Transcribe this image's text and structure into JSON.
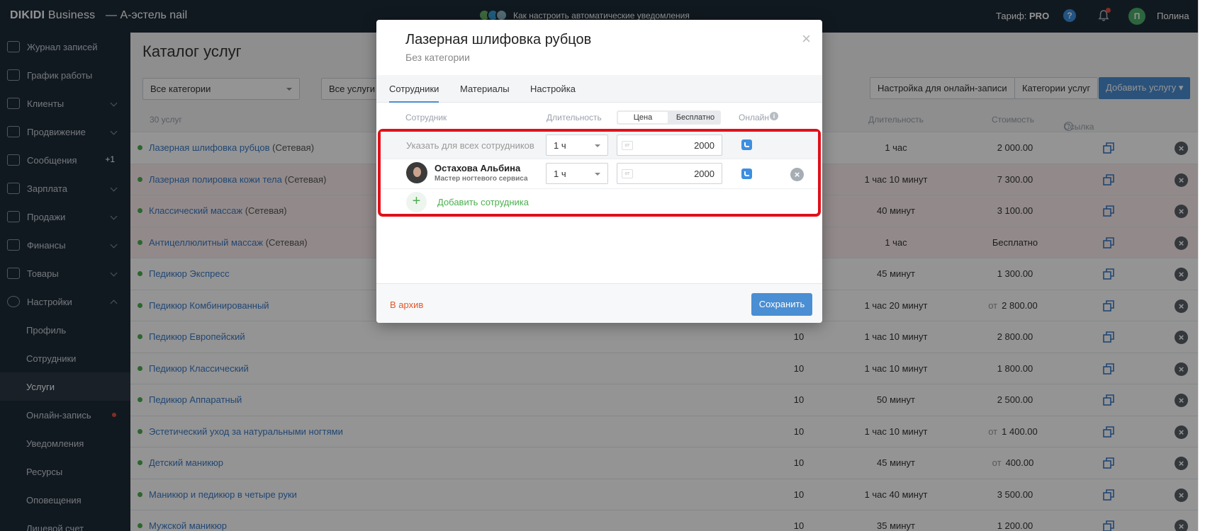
{
  "topbar": {
    "brand_bold": "DIKIDI",
    "brand_thin": " Business",
    "salon": "— А-эстель nail",
    "notify_banner": "Как настроить автоматические уведомления",
    "tariff_label": "Тариф:",
    "tariff_value": "PRO",
    "help": "?",
    "avatar_letter": "П",
    "username": "Полина"
  },
  "sidebar": {
    "items": [
      {
        "label": "Журнал записей"
      },
      {
        "label": "График работы"
      },
      {
        "label": "Клиенты"
      },
      {
        "label": "Продвижение"
      },
      {
        "label": "Сообщения",
        "badge": "+1"
      },
      {
        "label": "Зарплата"
      },
      {
        "label": "Продажи"
      },
      {
        "label": "Финансы"
      },
      {
        "label": "Товары"
      },
      {
        "label": "Настройки"
      }
    ],
    "sub_items": [
      "Профиль",
      "Сотрудники",
      "Услуги",
      "Онлайн-запись",
      "Уведомления",
      "Ресурсы",
      "Оповещения",
      "Лицевой счет"
    ]
  },
  "main": {
    "title": "Каталог услуг",
    "filter_category": "Все категории",
    "filter_services": "Все услуги",
    "btn_online": "Настройка для онлайн-записи",
    "btn_categories": "Категории услуг",
    "btn_add": "Добавить услугу ▾",
    "head": {
      "count": "30 услуг",
      "duration": "Длительность",
      "price": "Стоимость",
      "link": "Ссылка на запись"
    },
    "rows": [
      {
        "name": "Лазерная шлифовка рубцов",
        "net": " (Сетевая)",
        "count": "",
        "duration": "1 час",
        "from": "",
        "price": "2 000.00"
      },
      {
        "name": "Лазерная полировка кожи тела",
        "net": " (Сетевая)",
        "count": "",
        "duration": "1 час 10 минут",
        "from": "",
        "price": "7 300.00"
      },
      {
        "name": "Классический массаж",
        "net": " (Сетевая)",
        "count": "",
        "duration": "40 минут",
        "from": "",
        "price": "3 100.00"
      },
      {
        "name": "Антицеллюлитный массаж",
        "net": " (Сетевая)",
        "count": "",
        "duration": "1 час",
        "from": "",
        "price": "Бесплатно"
      },
      {
        "name": "Педикюр Экспресс",
        "net": "",
        "count": "",
        "duration": "45 минут",
        "from": "",
        "price": "1 300.00"
      },
      {
        "name": "Педикюр Комбинированный",
        "net": "",
        "count": "",
        "duration": "1 час 20 минут",
        "from": "от",
        "price": "2 800.00"
      },
      {
        "name": "Педикюр Европейский",
        "net": "",
        "count": "10",
        "duration": "1 час 10 минут",
        "from": "",
        "price": "2 800.00"
      },
      {
        "name": "Педикюр Классический",
        "net": "",
        "count": "10",
        "duration": "1 час 10 минут",
        "from": "",
        "price": "1 800.00"
      },
      {
        "name": "Педикюр Аппаратный",
        "net": "",
        "count": "10",
        "duration": "50 минут",
        "from": "",
        "price": "2 500.00"
      },
      {
        "name": "Эстетический уход за натуральными ногтями",
        "net": "",
        "count": "10",
        "duration": "1 час 10 минут",
        "from": "от",
        "price": "1 400.00"
      },
      {
        "name": "Детский маникюр",
        "net": "",
        "count": "10",
        "duration": "45 минут",
        "from": "от",
        "price": "400.00"
      },
      {
        "name": "Маникюр и педикюр в четыре руки",
        "net": "",
        "count": "10",
        "duration": "1 час 40 минут",
        "from": "",
        "price": "3 500.00"
      },
      {
        "name": "Мужской маникюр",
        "net": "",
        "count": "10",
        "duration": "35 минут",
        "from": "",
        "price": "1 200.00"
      }
    ]
  },
  "modal": {
    "title": "Лазерная шлифовка рубцов",
    "subtitle": "Без категории",
    "close": "×",
    "tabs": [
      "Сотрудники",
      "Материалы",
      "Настройка"
    ],
    "head_employee": "Сотрудник",
    "head_duration": "Длительность",
    "seg_price": "Цена",
    "seg_free": "Бесплатно",
    "head_online": "Онлайн",
    "info": "i",
    "all_label": "Указать для всех сотрудников",
    "all_duration": "1 ч",
    "all_price": "2000",
    "from_badge": "от",
    "employee": {
      "name": "Остахова Альбина",
      "role": "Мастер ногтевого сервиса",
      "duration": "1 ч",
      "price": "2000"
    },
    "remove": "×",
    "add_plus": "+",
    "add_label": "Добавить сотрудника",
    "archive": "В архив",
    "save": "Сохранить"
  }
}
